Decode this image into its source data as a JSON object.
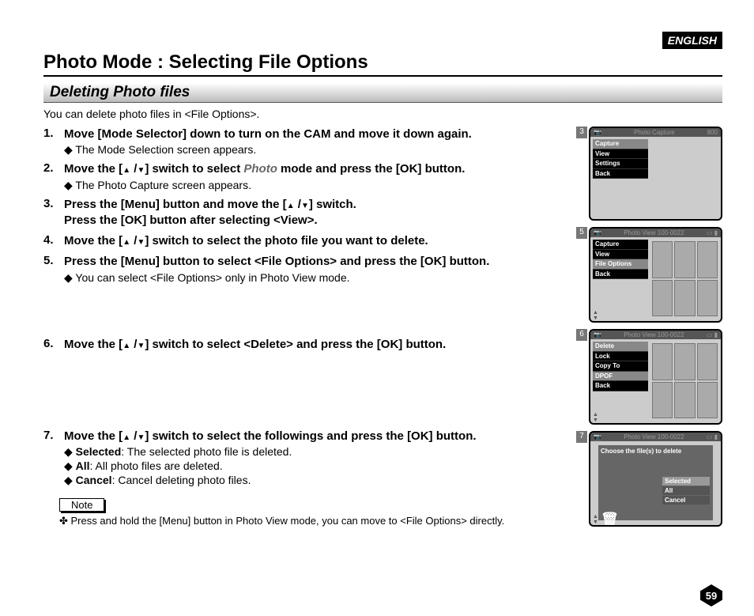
{
  "header": {
    "language": "ENGLISH",
    "title": "Photo Mode : Selecting File Options",
    "subsection": "Deleting Photo files",
    "intro": "You can delete photo files in <File Options>."
  },
  "steps": {
    "s1": {
      "num": "1.",
      "title_a": "Move [Mode Selector] down to turn on the CAM and move it down again.",
      "sub1": "The Mode Selection screen appears."
    },
    "s2": {
      "num": "2.",
      "title_a": "Move the [",
      "title_b": "] switch to select ",
      "title_italic": "Photo",
      "title_c": " mode and press the [OK] button.",
      "sub1": "The Photo Capture screen appears."
    },
    "s3": {
      "num": "3.",
      "line1a": "Press the [Menu] button and move the [",
      "line1b": "] switch.",
      "line2": "Press the [OK] button after selecting <View>."
    },
    "s4": {
      "num": "4.",
      "title_a": "Move the [",
      "title_b": "] switch to select the photo file you want to delete."
    },
    "s5": {
      "num": "5.",
      "title": "Press the [Menu] button to select <File Options> and press the [OK] button.",
      "sub1": "You can select <File Options> only in Photo View mode."
    },
    "s6": {
      "num": "6.",
      "title_a": "Move the [",
      "title_b": "] switch to select <Delete> and press the [OK] button."
    },
    "s7": {
      "num": "7.",
      "title_a": "Move the [",
      "title_b": "] switch to select the followings and press the [OK] button.",
      "opt1_b": "Selected",
      "opt1_t": ": The selected photo file is deleted.",
      "opt2_b": "All",
      "opt2_t": ": All photo files are deleted.",
      "opt3_b": "Cancel",
      "opt3_t": ": Cancel deleting photo files."
    }
  },
  "note": {
    "label": "Note",
    "text": "Press and hold the [Menu] button in Photo View mode, you can move to <File Options> directly."
  },
  "screens": {
    "sc3": {
      "num": "3",
      "title": "Photo Capture",
      "badge": "800",
      "menu": [
        "Capture",
        "View",
        "Settings",
        "Back"
      ],
      "sel": 0
    },
    "sc5": {
      "num": "5",
      "title": "Photo View 100-0022",
      "menu": [
        "Capture",
        "View",
        "File Options",
        "Back"
      ],
      "sel": 2
    },
    "sc6": {
      "num": "6",
      "title": "Photo View 100-0022",
      "menu": [
        "Delete",
        "Lock",
        "Copy To",
        "DPOF",
        "Back"
      ],
      "sel": 0
    },
    "sc7": {
      "num": "7",
      "title": "Photo View 100-0022",
      "prompt": "Choose the file(s) to delete",
      "buttons": [
        "Selected",
        "All",
        "Cancel"
      ],
      "sel": 0
    }
  },
  "page_number": "59"
}
